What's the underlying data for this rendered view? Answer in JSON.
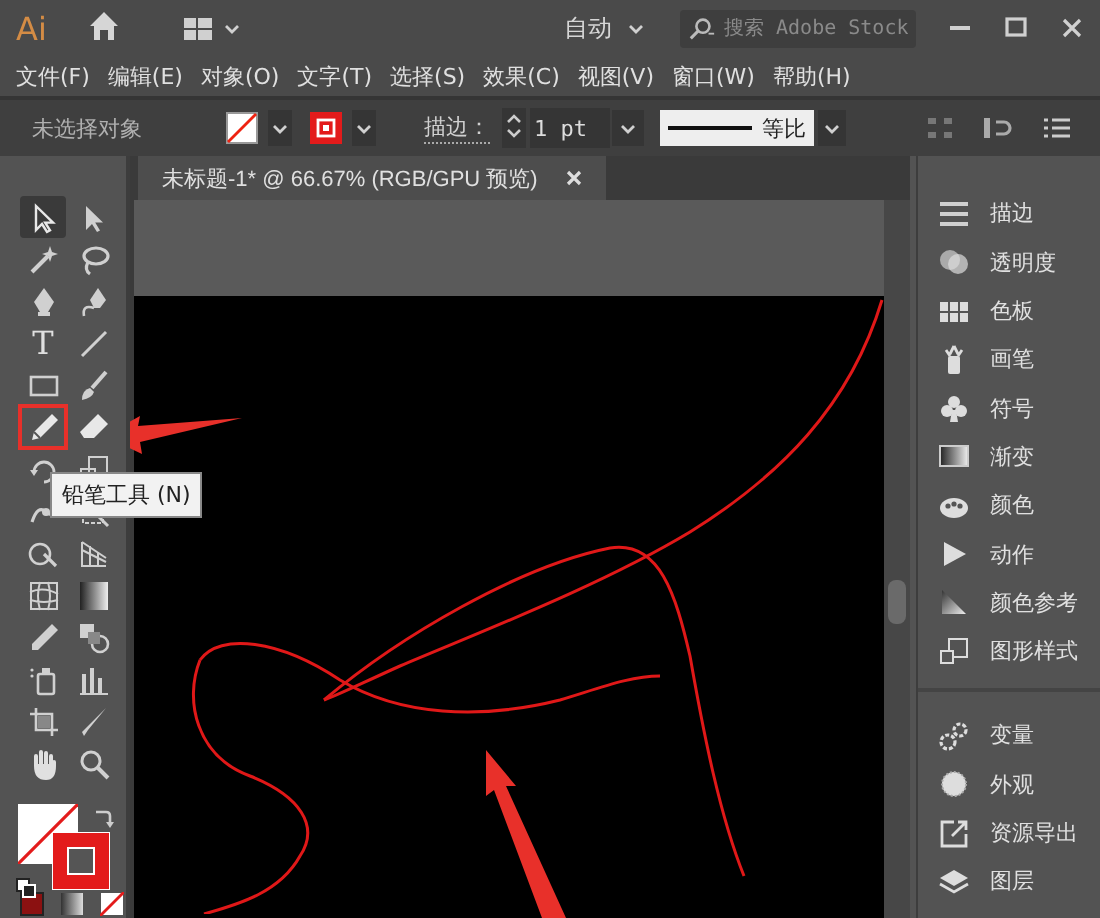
{
  "app": {
    "logo": "Ai"
  },
  "title_bar": {
    "workspace": "自动",
    "search": {
      "placeholder": "搜索 Adobe Stock"
    }
  },
  "menu": [
    "文件(F)",
    "编辑(E)",
    "对象(O)",
    "文字(T)",
    "选择(S)",
    "效果(C)",
    "视图(V)",
    "窗口(W)",
    "帮助(H)"
  ],
  "control_bar": {
    "selection": "未选择对象",
    "stroke_label": "描边：",
    "stroke_weight": "1 pt",
    "profile": "等比"
  },
  "tools": [
    {
      "selected": true,
      "highlighted": false
    },
    {
      "selected": false,
      "highlighted": false
    },
    {
      "selected": false,
      "highlighted": false
    },
    {
      "selected": false,
      "highlighted": false
    },
    {
      "selected": false,
      "highlighted": false
    },
    {
      "selected": false,
      "highlighted": false
    },
    {
      "selected": false,
      "highlighted": false,
      "glyph": "T"
    },
    {
      "selected": false,
      "highlighted": false
    },
    {
      "selected": false,
      "highlighted": false
    },
    {
      "selected": false,
      "highlighted": false
    },
    {
      "selected": false,
      "highlighted": true
    },
    {
      "selected": false,
      "highlighted": false
    },
    {
      "selected": false,
      "highlighted": false
    },
    {
      "selected": false,
      "highlighted": false
    },
    {
      "selected": false,
      "highlighted": false
    },
    {
      "selected": false,
      "highlighted": false
    },
    {
      "selected": false,
      "highlighted": false
    },
    {
      "selected": false,
      "highlighted": false
    },
    {
      "selected": false,
      "highlighted": false
    },
    {
      "selected": false,
      "highlighted": false
    },
    {
      "selected": false,
      "highlighted": false
    },
    {
      "selected": false,
      "highlighted": false
    },
    {
      "selected": false,
      "highlighted": false
    },
    {
      "selected": false,
      "highlighted": false
    },
    {
      "selected": false,
      "highlighted": false
    },
    {
      "selected": false,
      "highlighted": false
    },
    {
      "selected": false,
      "highlighted": false
    },
    {
      "selected": false,
      "highlighted": false
    }
  ],
  "tooltip": "铅笔工具 (N)",
  "document_tab": {
    "title": "未标题-1* @ 66.67% (RGB/GPU 预览)"
  },
  "panel_groups": [
    {
      "items": [
        "描边",
        "透明度",
        "色板",
        "画笔",
        "符号",
        "渐变",
        "颜色",
        "动作",
        "颜色参考",
        "图形样式"
      ]
    },
    {
      "items": [
        "变量",
        "外观",
        "资源导出",
        "图层"
      ]
    }
  ]
}
